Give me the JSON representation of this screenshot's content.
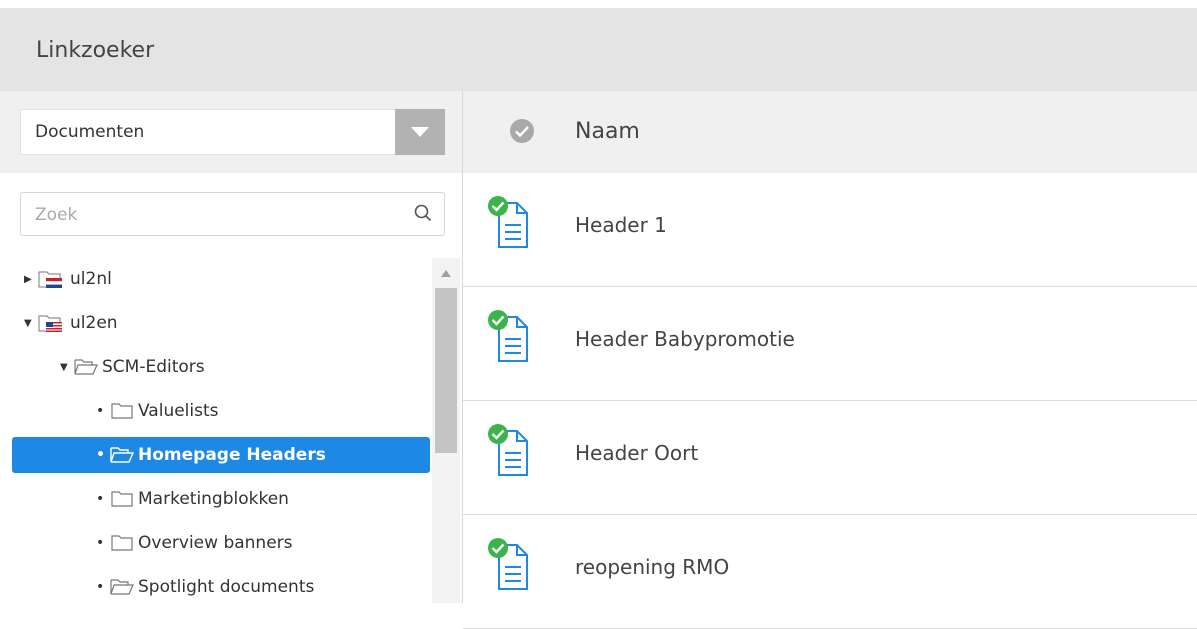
{
  "window": {
    "title": "Linkzoeker"
  },
  "left": {
    "select": {
      "value": "Documenten"
    },
    "search": {
      "placeholder": "Zoek",
      "value": ""
    },
    "tree": [
      {
        "label": "ul2nl",
        "icon": "folder-flag-nl-icon"
      },
      {
        "label": "ul2en",
        "icon": "folder-flag-us-icon"
      },
      {
        "label": "SCM-Editors",
        "icon": "folder-open-icon"
      },
      {
        "label": "Valuelists",
        "icon": "folder-icon"
      },
      {
        "label": "Homepage Headers",
        "icon": "folder-open-icon"
      },
      {
        "label": "Marketingblokken",
        "icon": "folder-icon"
      },
      {
        "label": "Overview banners",
        "icon": "folder-icon"
      },
      {
        "label": "Spotlight documents",
        "icon": "folder-open-icon"
      }
    ]
  },
  "main": {
    "column_header": "Naam",
    "rows": [
      {
        "label": "Header 1"
      },
      {
        "label": "Header Babypromotie"
      },
      {
        "label": "Header Oort"
      },
      {
        "label": "reopening RMO"
      }
    ]
  },
  "colors": {
    "accent": "#1e88e5",
    "published": "#3cb44b"
  }
}
